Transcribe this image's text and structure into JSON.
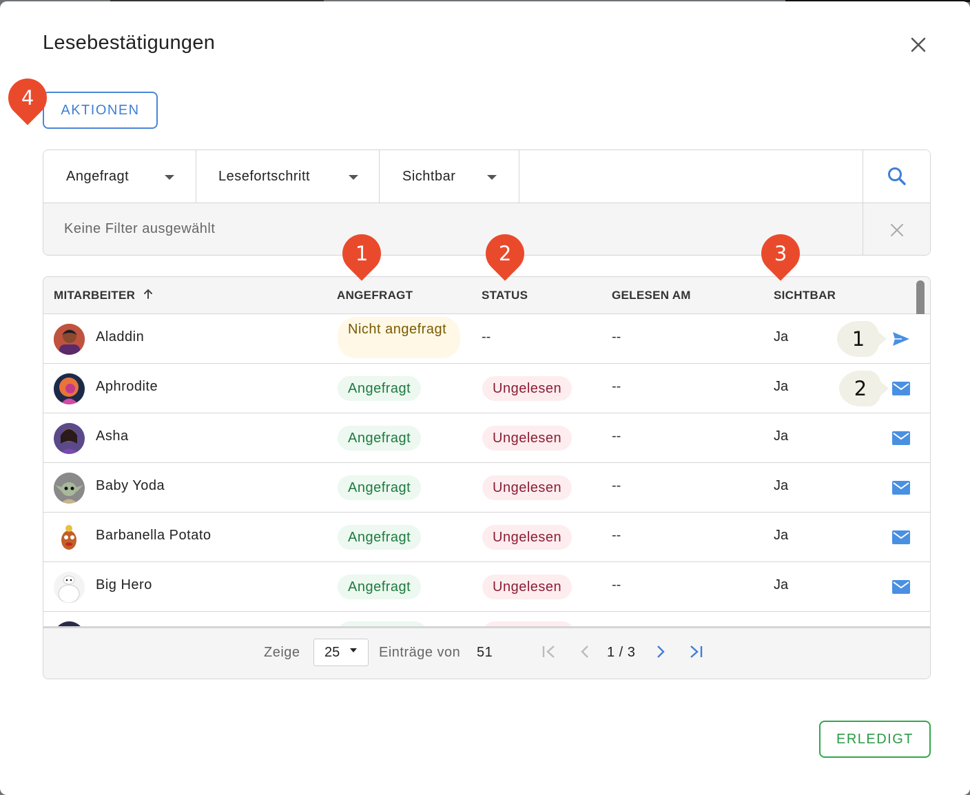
{
  "dialog": {
    "title": "Lesebestätigungen",
    "actions_label": "AKTIONEN",
    "done_label": "ERLEDIGT"
  },
  "filters": {
    "dropdowns": [
      "Angefragt",
      "Lesefortschritt",
      "Sichtbar"
    ],
    "no_filter_text": "Keine Filter ausgewählt"
  },
  "markers": [
    "1",
    "2",
    "3",
    "4"
  ],
  "table": {
    "headers": [
      "MITARBEITER",
      "ANGEFRAGT",
      "STATUS",
      "GELESEN AM",
      "SICHTBAR"
    ],
    "rows": [
      {
        "name": "Aladdin",
        "requested": "Nicht angefragt",
        "status": "--",
        "read_at": "--",
        "visible": "Ja",
        "action_icon": "send-icon",
        "bubble": "1"
      },
      {
        "name": "Aphrodite",
        "requested": "Angefragt",
        "status": "Ungelesen",
        "read_at": "--",
        "visible": "Ja",
        "action_icon": "mail-icon",
        "bubble": "2"
      },
      {
        "name": "Asha",
        "requested": "Angefragt",
        "status": "Ungelesen",
        "read_at": "--",
        "visible": "Ja",
        "action_icon": "mail-icon"
      },
      {
        "name": "Baby Yoda",
        "requested": "Angefragt",
        "status": "Ungelesen",
        "read_at": "--",
        "visible": "Ja",
        "action_icon": "mail-icon"
      },
      {
        "name": "Barbanella Potato",
        "requested": "Angefragt",
        "status": "Ungelesen",
        "read_at": "--",
        "visible": "Ja",
        "action_icon": "mail-icon"
      },
      {
        "name": "Big Hero",
        "requested": "Angefragt",
        "status": "Ungelesen",
        "read_at": "--",
        "visible": "Ja",
        "action_icon": "mail-icon"
      }
    ]
  },
  "pagination": {
    "show_label": "Zeige",
    "page_size": "25",
    "entries_of_label": "Einträge von",
    "total": "51",
    "page_indicator": "1 / 3"
  },
  "colors": {
    "accent_blue": "#3f7fd6",
    "marker_red": "#ea4a2c",
    "done_green": "#2a9a44"
  }
}
